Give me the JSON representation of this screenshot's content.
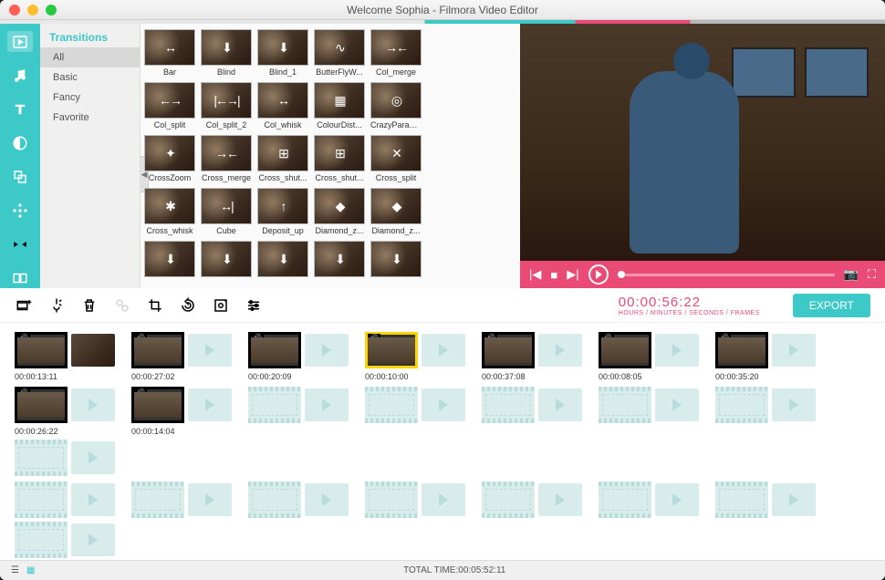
{
  "window": {
    "title": "Welcome Sophia - Filmora Video Editor"
  },
  "sidebar": {
    "icons": [
      "media",
      "music",
      "text",
      "filter",
      "overlay",
      "element",
      "transition",
      "split"
    ]
  },
  "categories": {
    "header": "Transitions",
    "items": [
      "All",
      "Basic",
      "Fancy",
      "Favorite"
    ],
    "active": 0
  },
  "transitions": [
    [
      "Bar",
      "Blind",
      "Blind_1",
      "ButterFlyW...",
      "Col_merge"
    ],
    [
      "Col_split",
      "Col_split_2",
      "Col_whisk",
      "ColourDist...",
      "CrazyParam..."
    ],
    [
      "CrossZoom",
      "Cross_merge",
      "Cross_shut...",
      "Cross_shut...",
      "Cross_split"
    ],
    [
      "Cross_whisk",
      "Cube",
      "Deposit_up",
      "Diamond_z...",
      "Diamond_z..."
    ]
  ],
  "transition_glyphs": [
    [
      "↔",
      "⬇",
      "⬇",
      "∿",
      "→←"
    ],
    [
      "←→",
      "|←→|",
      "↔",
      "▦",
      "◎"
    ],
    [
      "✦",
      "→←",
      "⊞",
      "⊞",
      "✕"
    ],
    [
      "✱",
      "↔|",
      "↑",
      "◆",
      "◆"
    ]
  ],
  "preview": {
    "controls": [
      "prev",
      "stop",
      "next",
      "play"
    ]
  },
  "timecode": {
    "value": "00:00:56:22",
    "label": "HOURS / MINUTES / SECONDS / FRAMES"
  },
  "export_label": "EXPORT",
  "toolbar": {
    "buttons": [
      "add",
      "voiceover",
      "delete",
      "speed",
      "crop",
      "rotate",
      "color",
      "adjust"
    ]
  },
  "clips_row1": [
    {
      "time": "00:00:13:11",
      "trans": true
    },
    {
      "time": "00:00:27:02"
    },
    {
      "time": "00:00:20:09"
    },
    {
      "time": "00:00:10:00",
      "selected": true
    },
    {
      "time": "00:00:37:08"
    },
    {
      "time": "00:00:08:05"
    },
    {
      "time": "00:00:35:20"
    }
  ],
  "clips_row2": [
    {
      "time": "00:00:26:22"
    },
    {
      "time": "00:00:14:04"
    }
  ],
  "empty_slots_row2": 6,
  "empty_slots_row3": 8,
  "footer": {
    "total": "TOTAL TIME:00:05:52:11"
  }
}
